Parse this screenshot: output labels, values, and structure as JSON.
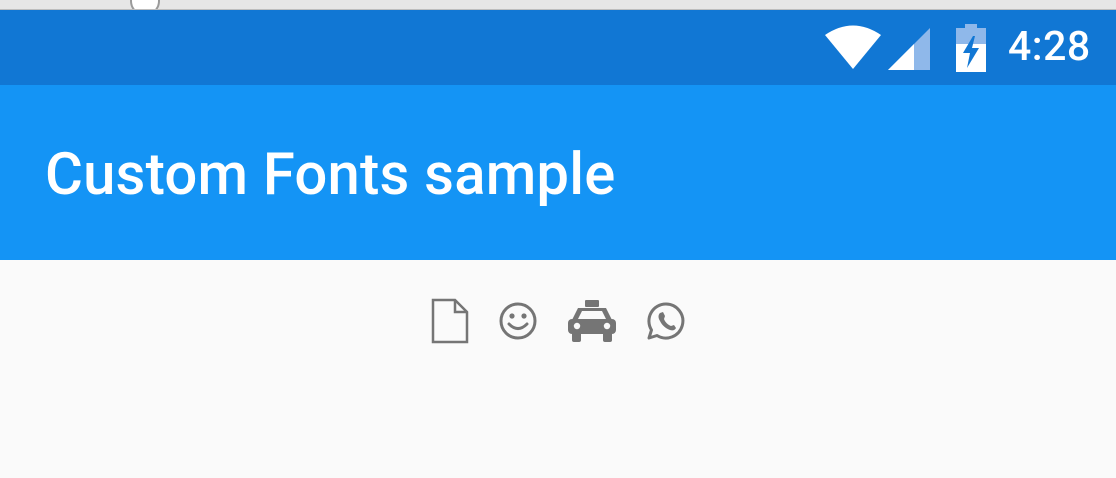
{
  "status_bar": {
    "time": "4:28",
    "background_color": "#1177d4",
    "icons": [
      "wifi-icon",
      "cellular-signal-icon",
      "battery-charging-icon"
    ]
  },
  "app_bar": {
    "title": "Custom Fonts sample",
    "background_color": "#1494f5"
  },
  "content": {
    "icons": [
      "file-icon",
      "smile-icon",
      "taxi-icon",
      "whatsapp-icon"
    ],
    "icon_color": "#757575"
  }
}
